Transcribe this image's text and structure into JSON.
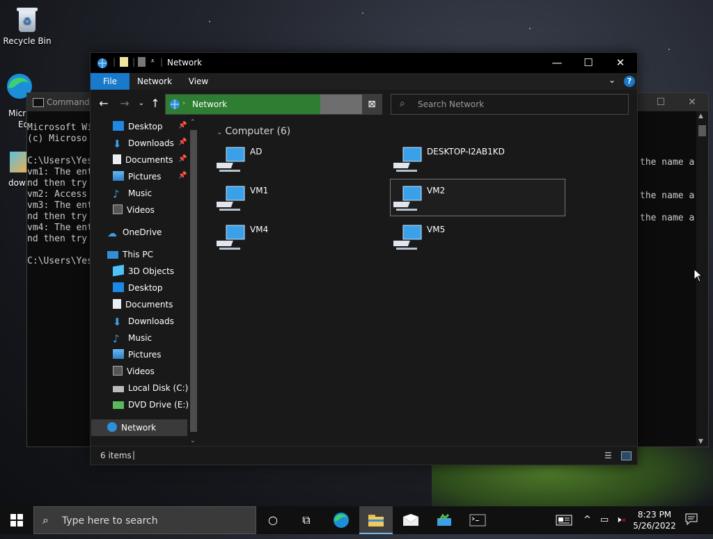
{
  "desktop": {
    "icons": [
      {
        "label": "Recycle Bin"
      },
      {
        "label": "Micr"
      },
      {
        "label": "Ed"
      },
      {
        "label": "dowr"
      }
    ]
  },
  "cmd": {
    "title": "Command",
    "lines": [
      "Microsoft Wi",
      "(c) Microso",
      "",
      "C:\\Users\\Yes",
      "vm1: The ent",
      "nd then try",
      "vm2: Access",
      "vm3: The ent",
      "nd then try",
      "vm4: The ent",
      "nd then try",
      "",
      "C:\\Users\\Yes"
    ],
    "right_fragment": "the name a"
  },
  "explorer": {
    "title": "Network",
    "ribbon_tabs": [
      "File",
      "Network",
      "View"
    ],
    "address": "Network",
    "search_placeholder": "Search Network",
    "group_header": "Computer (6)",
    "computers": [
      "AD",
      "DESKTOP-I2AB1KD",
      "VM1",
      "VM2",
      "VM4",
      "VM5"
    ],
    "selected": "VM2",
    "status_count": "6 items",
    "nav": {
      "quick_access": [
        "Desktop",
        "Downloads",
        "Documents",
        "Pictures",
        "Music",
        "Videos"
      ],
      "onedrive": "OneDrive",
      "this_pc": "This PC",
      "this_pc_items": [
        "3D Objects",
        "Desktop",
        "Documents",
        "Downloads",
        "Music",
        "Pictures",
        "Videos",
        "Local Disk (C:)",
        "DVD Drive (E:) C"
      ],
      "network": "Network"
    }
  },
  "taskbar": {
    "search_placeholder": "Type here to search",
    "time": "8:23 PM",
    "date": "5/26/2022"
  },
  "colors": {
    "accent": "#1979ca",
    "address_fill": "#2e7d32",
    "monitor": "#3aa0e8"
  }
}
